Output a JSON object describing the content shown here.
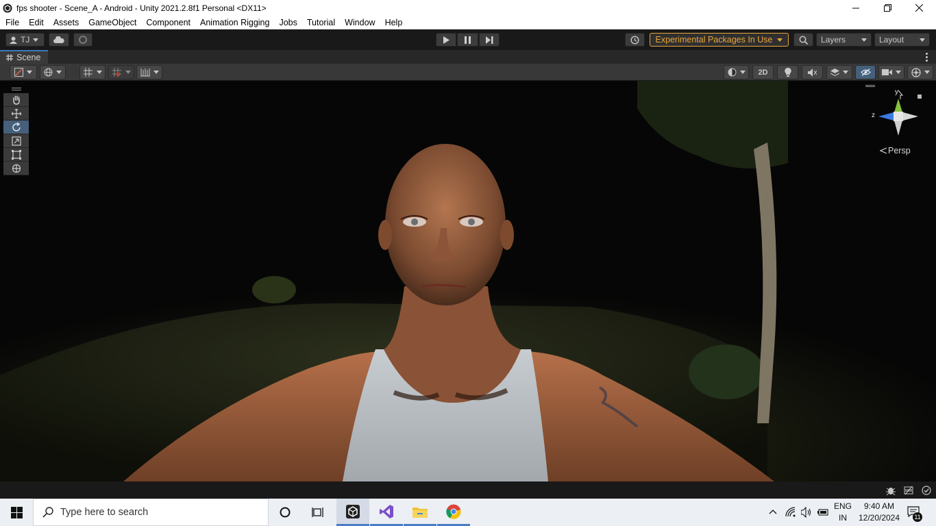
{
  "window": {
    "title": "fps shooter - Scene_A - Android - Unity 2021.2.8f1 Personal <DX11>"
  },
  "menu": [
    "File",
    "Edit",
    "Assets",
    "GameObject",
    "Component",
    "Animation Rigging",
    "Jobs",
    "Tutorial",
    "Window",
    "Help"
  ],
  "toolbar": {
    "account_label": "TJ",
    "experimental_label": "Experimental Packages In Use",
    "layers_label": "Layers",
    "layout_label": "Layout",
    "accent_color": "#e8a53b"
  },
  "scene": {
    "tab_label": "Scene",
    "mode_2d": "2D",
    "gizmo": {
      "y_label": "y",
      "z_label": "z",
      "projection_label": "Persp"
    }
  },
  "taskbar": {
    "search_placeholder": "Type here to search",
    "language_top": "ENG",
    "language_bottom": "IN",
    "time": "9:40 AM",
    "date": "12/20/2024",
    "notification_count": "11"
  }
}
